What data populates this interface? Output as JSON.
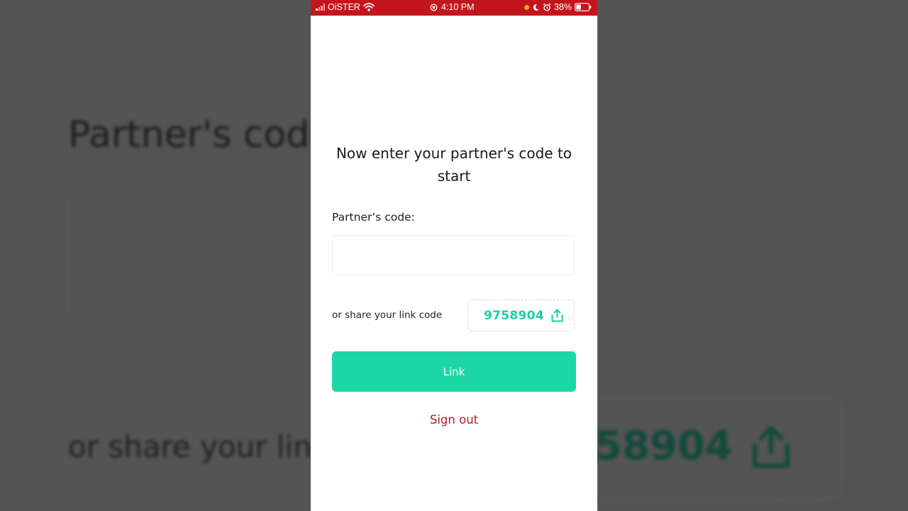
{
  "background": {
    "title": "Partner's cod",
    "share_text": "or share your lin",
    "code": "58904"
  },
  "status_bar": {
    "carrier": "OiSTER",
    "time": "4:10 PM",
    "battery": "38%"
  },
  "main": {
    "heading": "Now enter your partner's code to start",
    "partner_code_label": "Partner’s code:",
    "partner_code_value": "",
    "share_text": "or share your link code",
    "link_code": "9758904",
    "link_button": "Link",
    "sign_out": "Sign out"
  },
  "colors": {
    "accent": "#1dd6a6",
    "status_bar": "#c3161c",
    "sign_out": "#b3202a"
  },
  "icons": {
    "share": "share-icon",
    "wifi": "wifi-icon",
    "battery": "battery-icon",
    "alarm": "alarm-icon",
    "moon": "moon-icon",
    "location": "location-icon"
  }
}
